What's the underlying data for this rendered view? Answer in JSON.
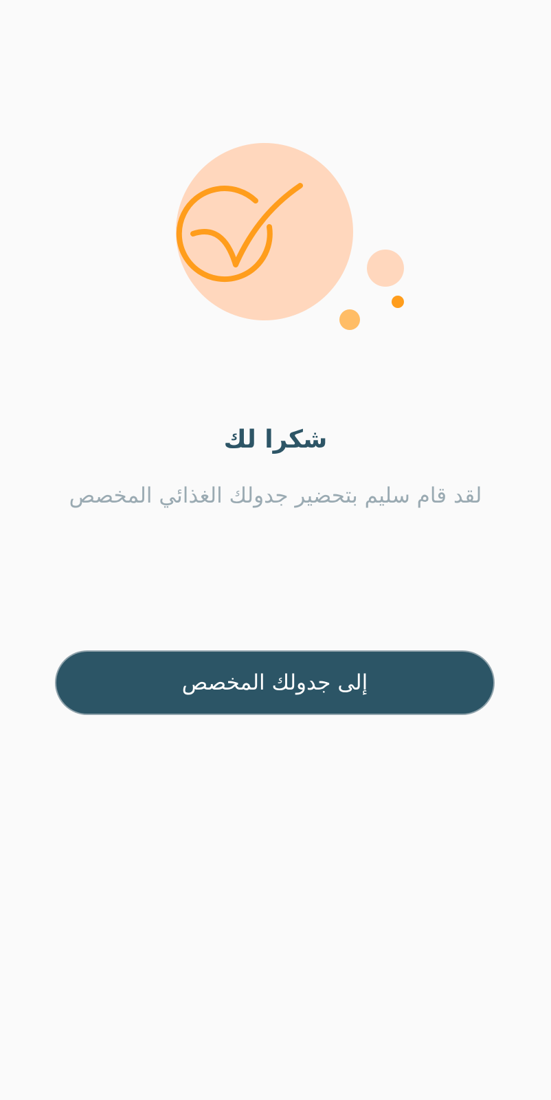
{
  "illustration": {
    "icon": "check-circle-icon",
    "colors": {
      "main_circle": "#ffd7bd",
      "check_stroke": "#ff9d1c",
      "dot_light": "#ffd7bd",
      "dot_medium": "#ffbd66",
      "dot_accent": "#ff9d1c"
    }
  },
  "content": {
    "title": "شكرا لك",
    "subtitle": "لقد قام سليم بتحضير جدولك الغذائي المخصص"
  },
  "actions": {
    "primary_label": "إلى جدولك المخصص"
  },
  "colors": {
    "background": "#fafafa",
    "title": "#2d5566",
    "subtitle": "#9aaab2",
    "button_fill": "#2c5566",
    "button_text": "#ffffff"
  }
}
